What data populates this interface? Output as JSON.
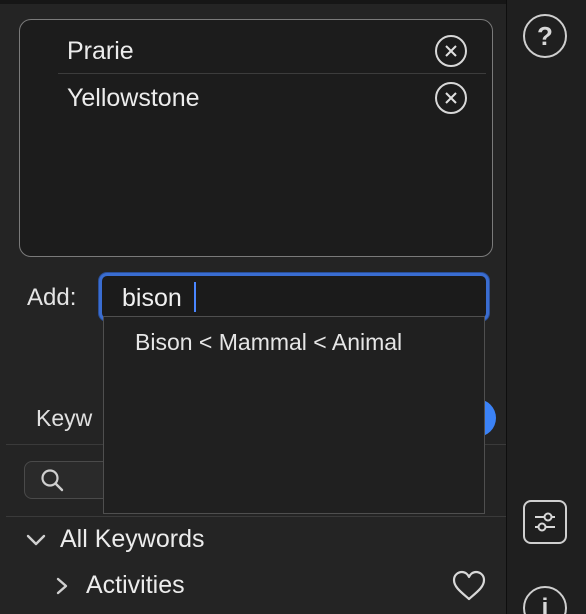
{
  "keywords_box": {
    "items": [
      {
        "label": "Prarie"
      },
      {
        "label": "Yellowstone"
      }
    ]
  },
  "add": {
    "label": "Add:",
    "value": "bison"
  },
  "autocomplete": {
    "suggestions": [
      "Bison < Mammal < Animal"
    ]
  },
  "keywords_section": {
    "heading": "Keyw"
  },
  "tree": {
    "root": "All Keywords",
    "child": "Activities"
  },
  "icons": {
    "help": "question-circle-icon",
    "adjust": "sliders-icon",
    "info": "info-circle-icon",
    "remove": "x-circle-icon",
    "search": "magnifier-icon",
    "favorite": "heart-icon"
  },
  "colors": {
    "accent": "#3a6dd1",
    "toggle": "#3b82f6",
    "background": "#242424"
  }
}
